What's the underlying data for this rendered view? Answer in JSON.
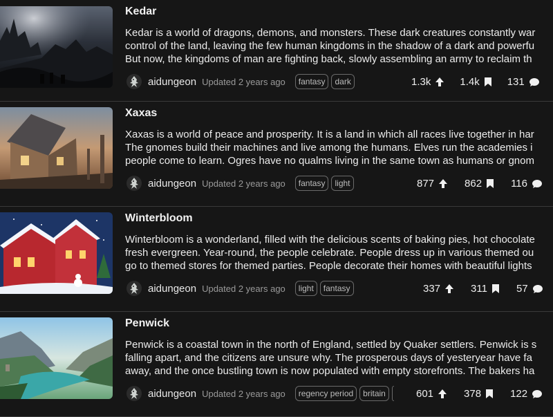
{
  "worlds": [
    {
      "title": "Kedar",
      "description": [
        "Kedar is a world of dragons, demons, and monsters. These dark creatures constantly war",
        "control of the land, leaving the few human kingdoms in the shadow of a dark and powerfu",
        "But now, the kingdoms of man are fighting back, slowly assembling an army to reclaim th"
      ],
      "author": "aidungeon",
      "updated": "Updated 2 years ago",
      "tags": [
        "fantasy",
        "dark"
      ],
      "upvotes": "1.3k",
      "saves": "1.4k",
      "comments": "131",
      "thumbnail": "dark-castle-landscape"
    },
    {
      "title": "Xaxas",
      "description": [
        "Xaxas is a world of peace and prosperity. It is a land in which all races live together in har",
        "The gnomes build their machines and live among the humans. Elves run the academies i",
        "people come to learn. Ogres have no qualms living in the same town as humans or gnom"
      ],
      "author": "aidungeon",
      "updated": "Updated 2 years ago",
      "tags": [
        "fantasy",
        "light"
      ],
      "upvotes": "877",
      "saves": "862",
      "comments": "116",
      "thumbnail": "cottage-sunset"
    },
    {
      "title": "Winterbloom",
      "description": [
        "Winterbloom is a wonderland, filled with the delicious scents of baking pies, hot chocolate",
        "fresh evergreen. Year-round, the people celebrate. People dress up in various themed ou",
        "go to themed stores for themed parties. People decorate their homes with beautiful lights"
      ],
      "author": "aidungeon",
      "updated": "Updated 2 years ago",
      "tags": [
        "light",
        "fantasy"
      ],
      "upvotes": "337",
      "saves": "311",
      "comments": "57",
      "thumbnail": "snowy-christmas-house"
    },
    {
      "title": "Penwick",
      "description": [
        "Penwick is a coastal town in the north of England, settled by Quaker settlers. Penwick is s",
        "falling apart, and the citizens are unsure why. The prosperous days of yesteryear have fa",
        "away, and the once bustling town is now populated with empty storefronts. The bakers ha"
      ],
      "author": "aidungeon",
      "updated": "Updated 2 years ago",
      "tags": [
        "regency period",
        "britain",
        ""
      ],
      "upvotes": "601",
      "saves": "378",
      "comments": "122",
      "thumbnail": "coastal-valley"
    }
  ],
  "colors": {
    "background": "#161616",
    "divider": "#3a3a3a",
    "text": "#ececec",
    "muted": "#9a9a9a",
    "tag_border": "#6b6b6b"
  },
  "icons": {
    "upvote": "arrow-up-icon",
    "save": "bookmark-icon",
    "comment": "comment-bubble-icon",
    "avatar": "avatar-dungeon-icon"
  }
}
